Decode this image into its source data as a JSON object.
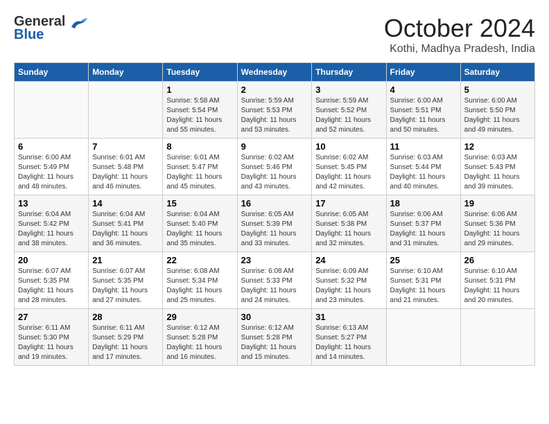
{
  "logo": {
    "line1": "General",
    "line2": "Blue"
  },
  "title": "October 2024",
  "location": "Kothi, Madhya Pradesh, India",
  "days_header": [
    "Sunday",
    "Monday",
    "Tuesday",
    "Wednesday",
    "Thursday",
    "Friday",
    "Saturday"
  ],
  "weeks": [
    [
      {
        "day": "",
        "info": ""
      },
      {
        "day": "",
        "info": ""
      },
      {
        "day": "1",
        "info": "Sunrise: 5:58 AM\nSunset: 5:54 PM\nDaylight: 11 hours and 55 minutes."
      },
      {
        "day": "2",
        "info": "Sunrise: 5:59 AM\nSunset: 5:53 PM\nDaylight: 11 hours and 53 minutes."
      },
      {
        "day": "3",
        "info": "Sunrise: 5:59 AM\nSunset: 5:52 PM\nDaylight: 11 hours and 52 minutes."
      },
      {
        "day": "4",
        "info": "Sunrise: 6:00 AM\nSunset: 5:51 PM\nDaylight: 11 hours and 50 minutes."
      },
      {
        "day": "5",
        "info": "Sunrise: 6:00 AM\nSunset: 5:50 PM\nDaylight: 11 hours and 49 minutes."
      }
    ],
    [
      {
        "day": "6",
        "info": "Sunrise: 6:00 AM\nSunset: 5:49 PM\nDaylight: 11 hours and 48 minutes."
      },
      {
        "day": "7",
        "info": "Sunrise: 6:01 AM\nSunset: 5:48 PM\nDaylight: 11 hours and 46 minutes."
      },
      {
        "day": "8",
        "info": "Sunrise: 6:01 AM\nSunset: 5:47 PM\nDaylight: 11 hours and 45 minutes."
      },
      {
        "day": "9",
        "info": "Sunrise: 6:02 AM\nSunset: 5:46 PM\nDaylight: 11 hours and 43 minutes."
      },
      {
        "day": "10",
        "info": "Sunrise: 6:02 AM\nSunset: 5:45 PM\nDaylight: 11 hours and 42 minutes."
      },
      {
        "day": "11",
        "info": "Sunrise: 6:03 AM\nSunset: 5:44 PM\nDaylight: 11 hours and 40 minutes."
      },
      {
        "day": "12",
        "info": "Sunrise: 6:03 AM\nSunset: 5:43 PM\nDaylight: 11 hours and 39 minutes."
      }
    ],
    [
      {
        "day": "13",
        "info": "Sunrise: 6:04 AM\nSunset: 5:42 PM\nDaylight: 11 hours and 38 minutes."
      },
      {
        "day": "14",
        "info": "Sunrise: 6:04 AM\nSunset: 5:41 PM\nDaylight: 11 hours and 36 minutes."
      },
      {
        "day": "15",
        "info": "Sunrise: 6:04 AM\nSunset: 5:40 PM\nDaylight: 11 hours and 35 minutes."
      },
      {
        "day": "16",
        "info": "Sunrise: 6:05 AM\nSunset: 5:39 PM\nDaylight: 11 hours and 33 minutes."
      },
      {
        "day": "17",
        "info": "Sunrise: 6:05 AM\nSunset: 5:38 PM\nDaylight: 11 hours and 32 minutes."
      },
      {
        "day": "18",
        "info": "Sunrise: 6:06 AM\nSunset: 5:37 PM\nDaylight: 11 hours and 31 minutes."
      },
      {
        "day": "19",
        "info": "Sunrise: 6:06 AM\nSunset: 5:36 PM\nDaylight: 11 hours and 29 minutes."
      }
    ],
    [
      {
        "day": "20",
        "info": "Sunrise: 6:07 AM\nSunset: 5:35 PM\nDaylight: 11 hours and 28 minutes."
      },
      {
        "day": "21",
        "info": "Sunrise: 6:07 AM\nSunset: 5:35 PM\nDaylight: 11 hours and 27 minutes."
      },
      {
        "day": "22",
        "info": "Sunrise: 6:08 AM\nSunset: 5:34 PM\nDaylight: 11 hours and 25 minutes."
      },
      {
        "day": "23",
        "info": "Sunrise: 6:08 AM\nSunset: 5:33 PM\nDaylight: 11 hours and 24 minutes."
      },
      {
        "day": "24",
        "info": "Sunrise: 6:09 AM\nSunset: 5:32 PM\nDaylight: 11 hours and 23 minutes."
      },
      {
        "day": "25",
        "info": "Sunrise: 6:10 AM\nSunset: 5:31 PM\nDaylight: 11 hours and 21 minutes."
      },
      {
        "day": "26",
        "info": "Sunrise: 6:10 AM\nSunset: 5:31 PM\nDaylight: 11 hours and 20 minutes."
      }
    ],
    [
      {
        "day": "27",
        "info": "Sunrise: 6:11 AM\nSunset: 5:30 PM\nDaylight: 11 hours and 19 minutes."
      },
      {
        "day": "28",
        "info": "Sunrise: 6:11 AM\nSunset: 5:29 PM\nDaylight: 11 hours and 17 minutes."
      },
      {
        "day": "29",
        "info": "Sunrise: 6:12 AM\nSunset: 5:28 PM\nDaylight: 11 hours and 16 minutes."
      },
      {
        "day": "30",
        "info": "Sunrise: 6:12 AM\nSunset: 5:28 PM\nDaylight: 11 hours and 15 minutes."
      },
      {
        "day": "31",
        "info": "Sunrise: 6:13 AM\nSunset: 5:27 PM\nDaylight: 11 hours and 14 minutes."
      },
      {
        "day": "",
        "info": ""
      },
      {
        "day": "",
        "info": ""
      }
    ]
  ]
}
